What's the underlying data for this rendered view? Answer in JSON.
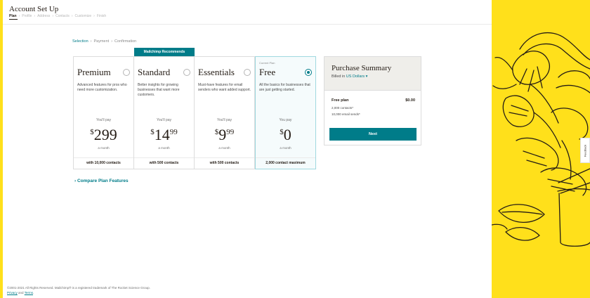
{
  "header": {
    "title": "Account Set Up",
    "steps": [
      "Plan",
      "Profile",
      "Address",
      "Contacts",
      "Customize",
      "Finish"
    ]
  },
  "breadcrumb": [
    "Selection",
    "Payment",
    "Confirmation"
  ],
  "recommend_badge": "Mailchimp Recommends",
  "plans": [
    {
      "name": "Premium",
      "desc": "Advanced features for pros who need more customization.",
      "pay_label": "You'll pay",
      "currency": "$",
      "amount": "299",
      "cents": "",
      "per": "a month",
      "contacts": "with 10,000 contacts",
      "selected": false,
      "current_label": ""
    },
    {
      "name": "Standard",
      "desc": "Better insights for growing businesses that want more customers.",
      "pay_label": "You'll pay",
      "currency": "$",
      "amount": "14",
      "cents": "99",
      "per": "a month",
      "contacts": "with 500 contacts",
      "selected": false,
      "current_label": ""
    },
    {
      "name": "Essentials",
      "desc": "Must-have features for email senders who want added support.",
      "pay_label": "You'll pay",
      "currency": "$",
      "amount": "9",
      "cents": "99",
      "per": "a month",
      "contacts": "with 500 contacts",
      "selected": false,
      "current_label": ""
    },
    {
      "name": "Free",
      "desc": "All the basics for businesses that are just getting started.",
      "pay_label": "You pay",
      "currency": "$",
      "amount": "0",
      "cents": "",
      "per": "a month",
      "contacts": "2,000 contact maximum",
      "selected": true,
      "current_label": "Current Plan"
    }
  ],
  "summary": {
    "title": "Purchase Summary",
    "billed_prefix": "Billed in",
    "currency_select": "US Dollars",
    "plan_label": "Free plan",
    "plan_price": "$0.00",
    "contacts_line": "2,000 contacts*",
    "sends_line": "10,000 email sends*",
    "next_label": "Next"
  },
  "compare_link": "Compare Plan Features",
  "footer": {
    "copyright": "©2001-2021 All Rights Reserved. Mailchimp® is a registered trademark of The Rocket Science Group.",
    "privacy": "Privacy",
    "and": "and",
    "terms": "Terms"
  },
  "feedback_label": "Feedback",
  "colors": {
    "brand_yellow": "#ffe01b",
    "accent_teal": "#007c89"
  }
}
